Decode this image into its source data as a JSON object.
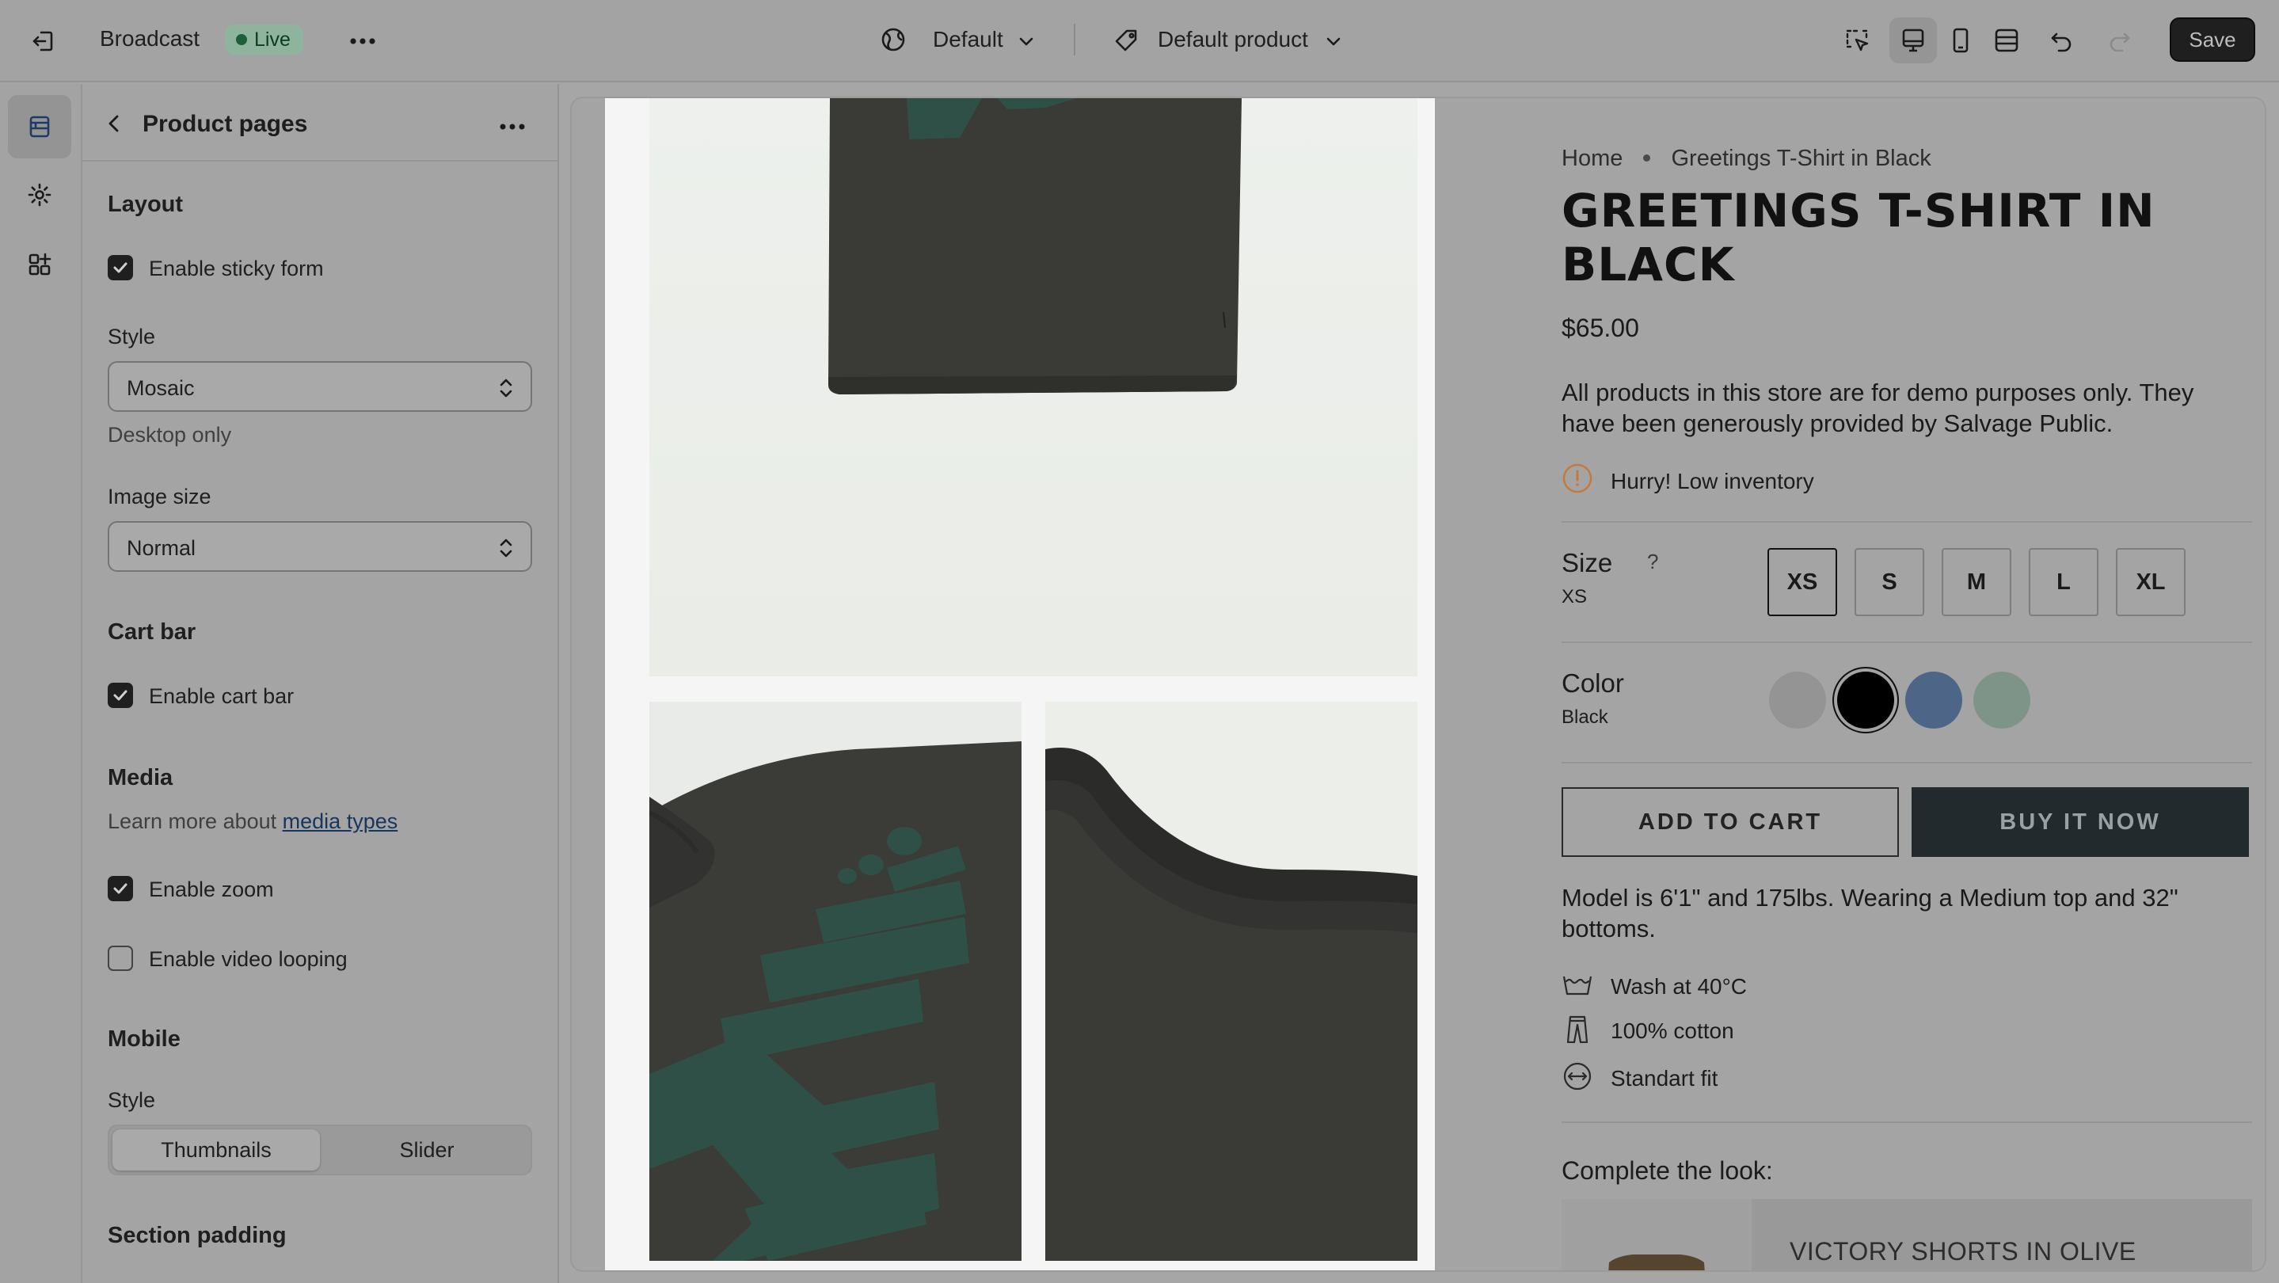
{
  "topbar": {
    "store_name": "Broadcast",
    "status": "Live",
    "theme_select": "Default",
    "template_select": "Default product",
    "save_label": "Save"
  },
  "sidebar": {
    "title": "Product pages",
    "layout": {
      "heading": "Layout",
      "sticky_form_label": "Enable sticky form",
      "sticky_form_checked": true,
      "style_label": "Style",
      "style_value": "Mosaic",
      "style_hint": "Desktop only",
      "image_size_label": "Image size",
      "image_size_value": "Normal"
    },
    "cart_bar": {
      "heading": "Cart bar",
      "enable_label": "Enable cart bar",
      "checked": true
    },
    "media": {
      "heading": "Media",
      "learn_prefix": "Learn more about",
      "learn_link": "media types",
      "zoom_label": "Enable zoom",
      "zoom_checked": true,
      "looping_label": "Enable video looping",
      "looping_checked": false
    },
    "mobile": {
      "heading": "Mobile",
      "style_label": "Style",
      "options": [
        "Thumbnails",
        "Slider"
      ],
      "selected": "Thumbnails"
    },
    "section_padding": {
      "heading": "Section padding"
    }
  },
  "product": {
    "breadcrumb": [
      "Home",
      "Greetings T-Shirt in Black"
    ],
    "title_line1": "GREETINGS T-SHIRT IN",
    "title_line2": "BLACK",
    "price": "$65.00",
    "description_line1": "All products in this store are for demo purposes only. They",
    "description_line2": "have been generously provided by Salvage Public.",
    "inventory": "Hurry! Low inventory",
    "size": {
      "label": "Size",
      "help": "?",
      "selected": "XS",
      "options": [
        "XS",
        "S",
        "M",
        "L",
        "XL"
      ]
    },
    "color": {
      "label": "Color",
      "selected": "Black",
      "swatches": [
        "#949494",
        "#000000",
        "#4d6587",
        "#7f9488"
      ]
    },
    "add_to_cart": "ADD TO CART",
    "buy_now": "BUY IT NOW",
    "model_line1": "Model is 6'1\" and 175lbs. Wearing a Medium top and 32\"",
    "model_line2": "bottoms.",
    "features": [
      {
        "icon": "wash-icon",
        "text": "Wash at 40°C"
      },
      {
        "icon": "pants-icon",
        "text": "100% cotton"
      },
      {
        "icon": "fit-icon",
        "text": "Standart fit"
      }
    ],
    "complete_look_heading": "Complete the look:",
    "recommendation": "VICTORY SHORTS IN OLIVE"
  },
  "colors": {
    "accent_dark": "#1f1f1f",
    "live_badge": "#8fb49e",
    "buy_button": "#232a2e",
    "shirt_print": "#2e5047"
  }
}
